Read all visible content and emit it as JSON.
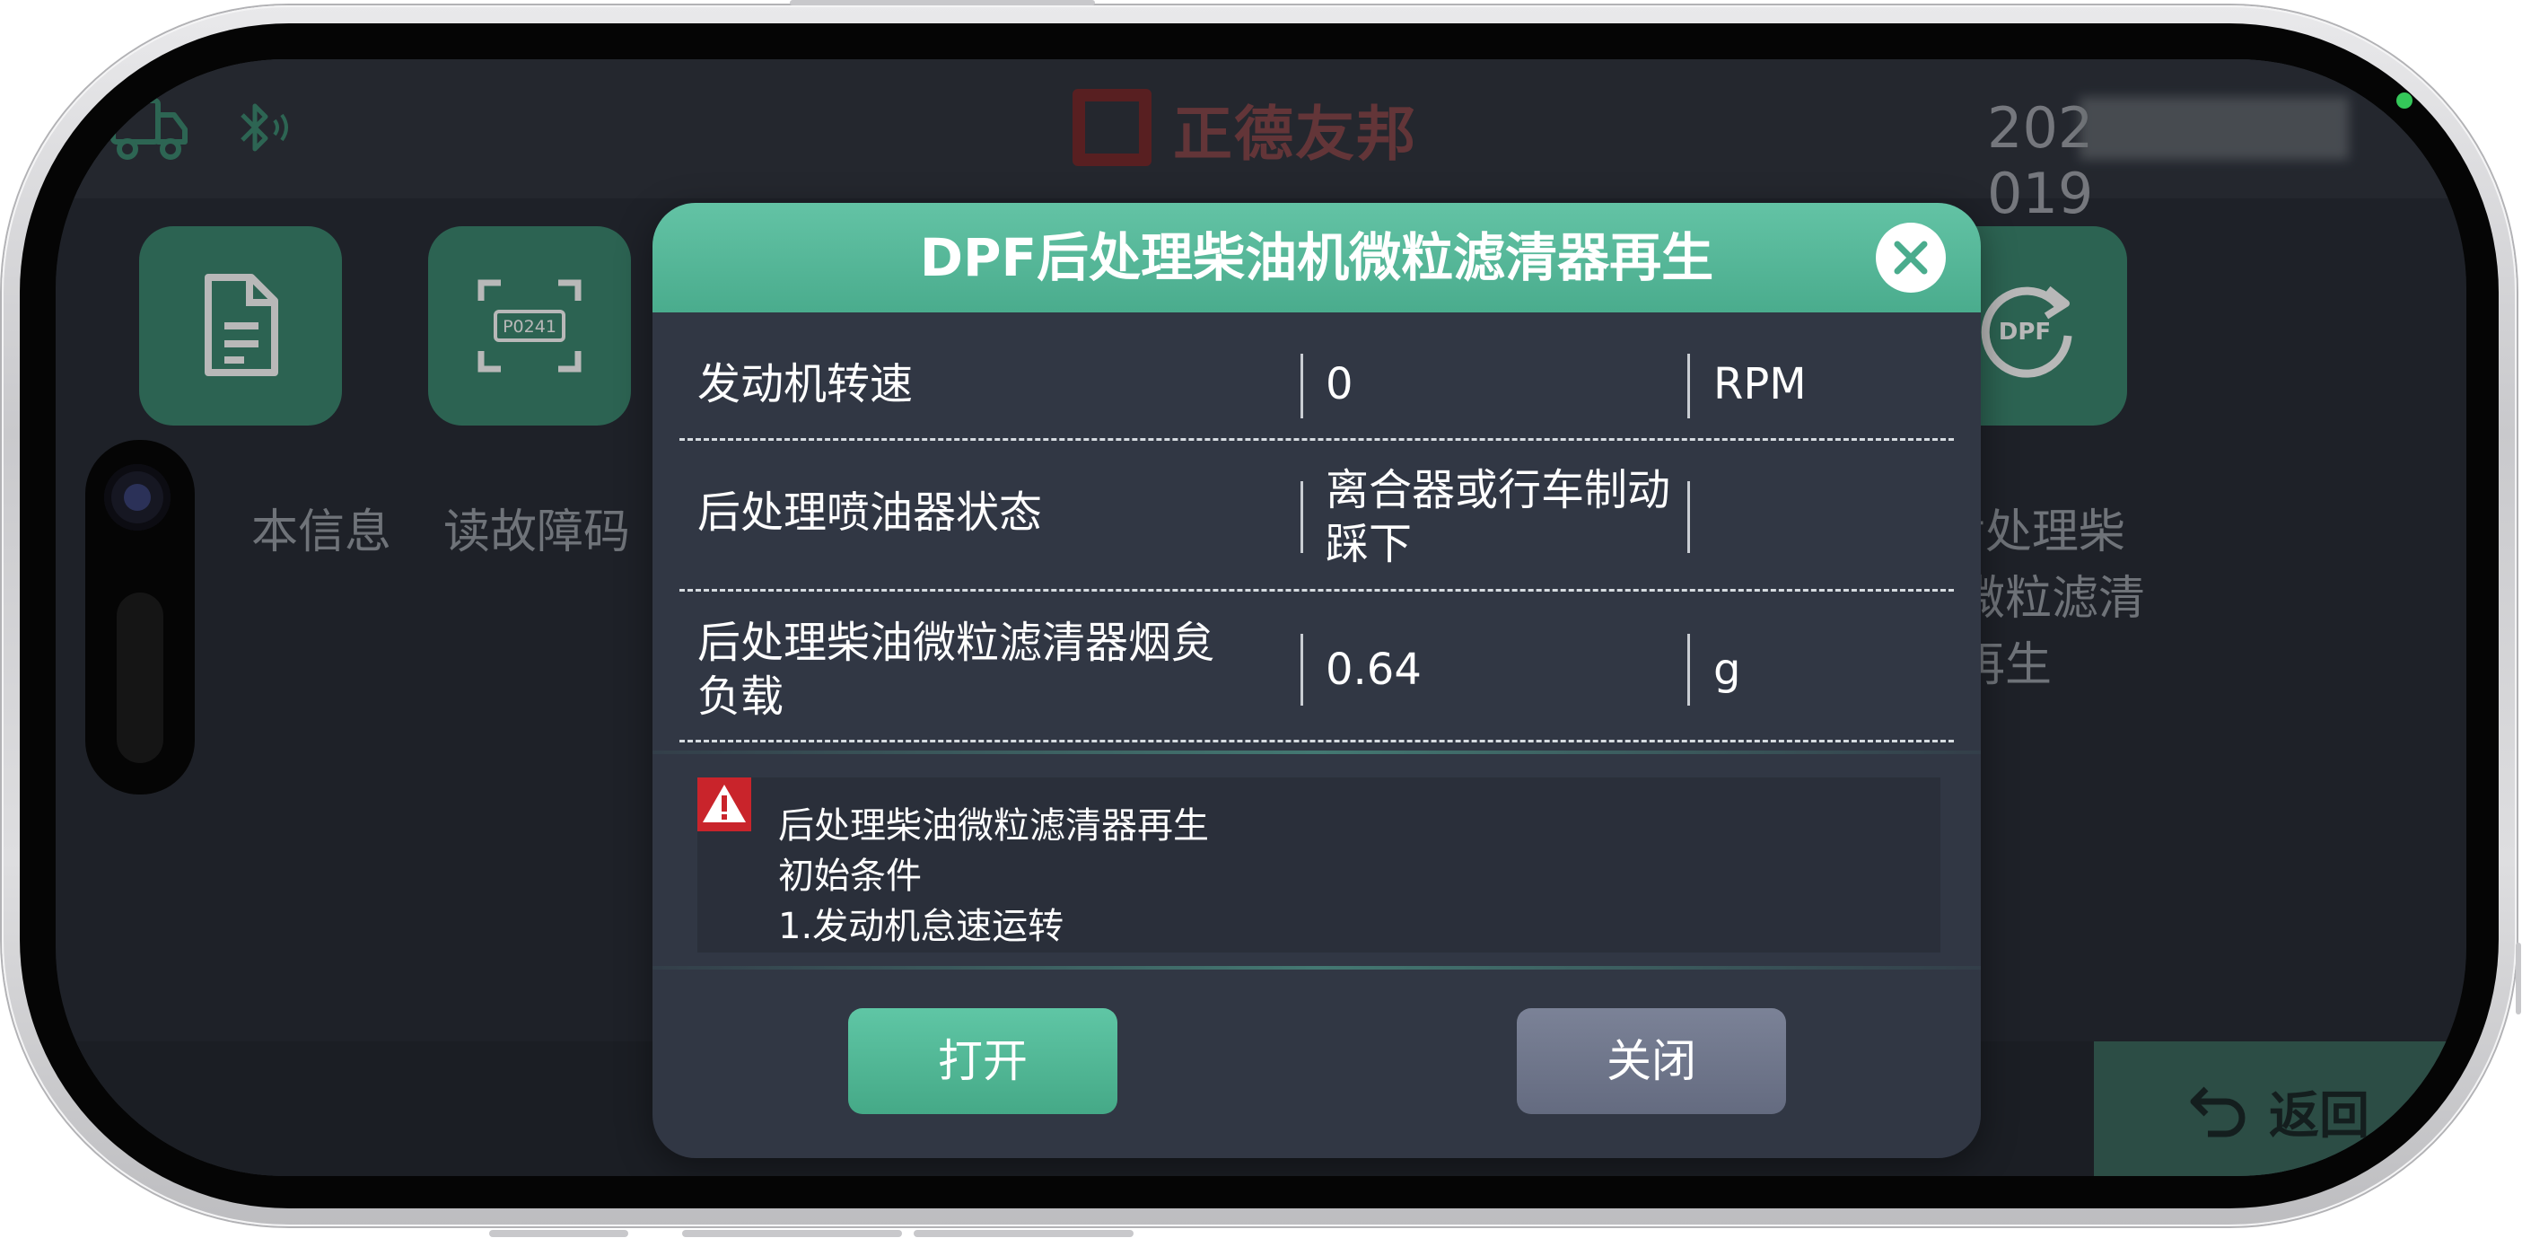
{
  "topbar": {
    "brand": "正德友邦",
    "datetime_prefix": "202",
    "datetime_suffix": "019",
    "icons": [
      "truck-icon",
      "bluetooth-icon"
    ]
  },
  "tiles": [
    {
      "label": "版本信息",
      "visible_label": "本信息",
      "icon": "document-icon"
    },
    {
      "label": "读故障码",
      "visible_label": "读故障码",
      "icon": "fault-code-icon",
      "code": "P0241"
    },
    {
      "label": "DPF后处理柴油机微粒滤清器再生",
      "visible_label": "F后处理柴\n机微粒滤清\n器再生",
      "icon": "dpf-regen-icon",
      "code": "DPF"
    }
  ],
  "back": {
    "label": "返回"
  },
  "dialog": {
    "title": "DPF后处理柴油机微粒滤清器再生",
    "rows": [
      {
        "name": "发动机转速",
        "value": "0",
        "unit": "RPM"
      },
      {
        "name": "后处理喷油器状态",
        "value": "离合器或行车制动踩下",
        "unit": ""
      },
      {
        "name": "后处理柴油微粒滤清器烟炱负载",
        "value": "0.64",
        "unit": "g"
      }
    ],
    "notice": {
      "line1": "后处理柴油微粒滤清器再生",
      "line2": "初始条件",
      "line3": "1.发动机怠速运转"
    },
    "open_label": "打开",
    "close_label": "关闭"
  },
  "colors": {
    "accent": "#4aac8d",
    "dialog_bg": "#313744",
    "screen_bg": "#2a2f38",
    "secondary_button": "#6b7287"
  }
}
